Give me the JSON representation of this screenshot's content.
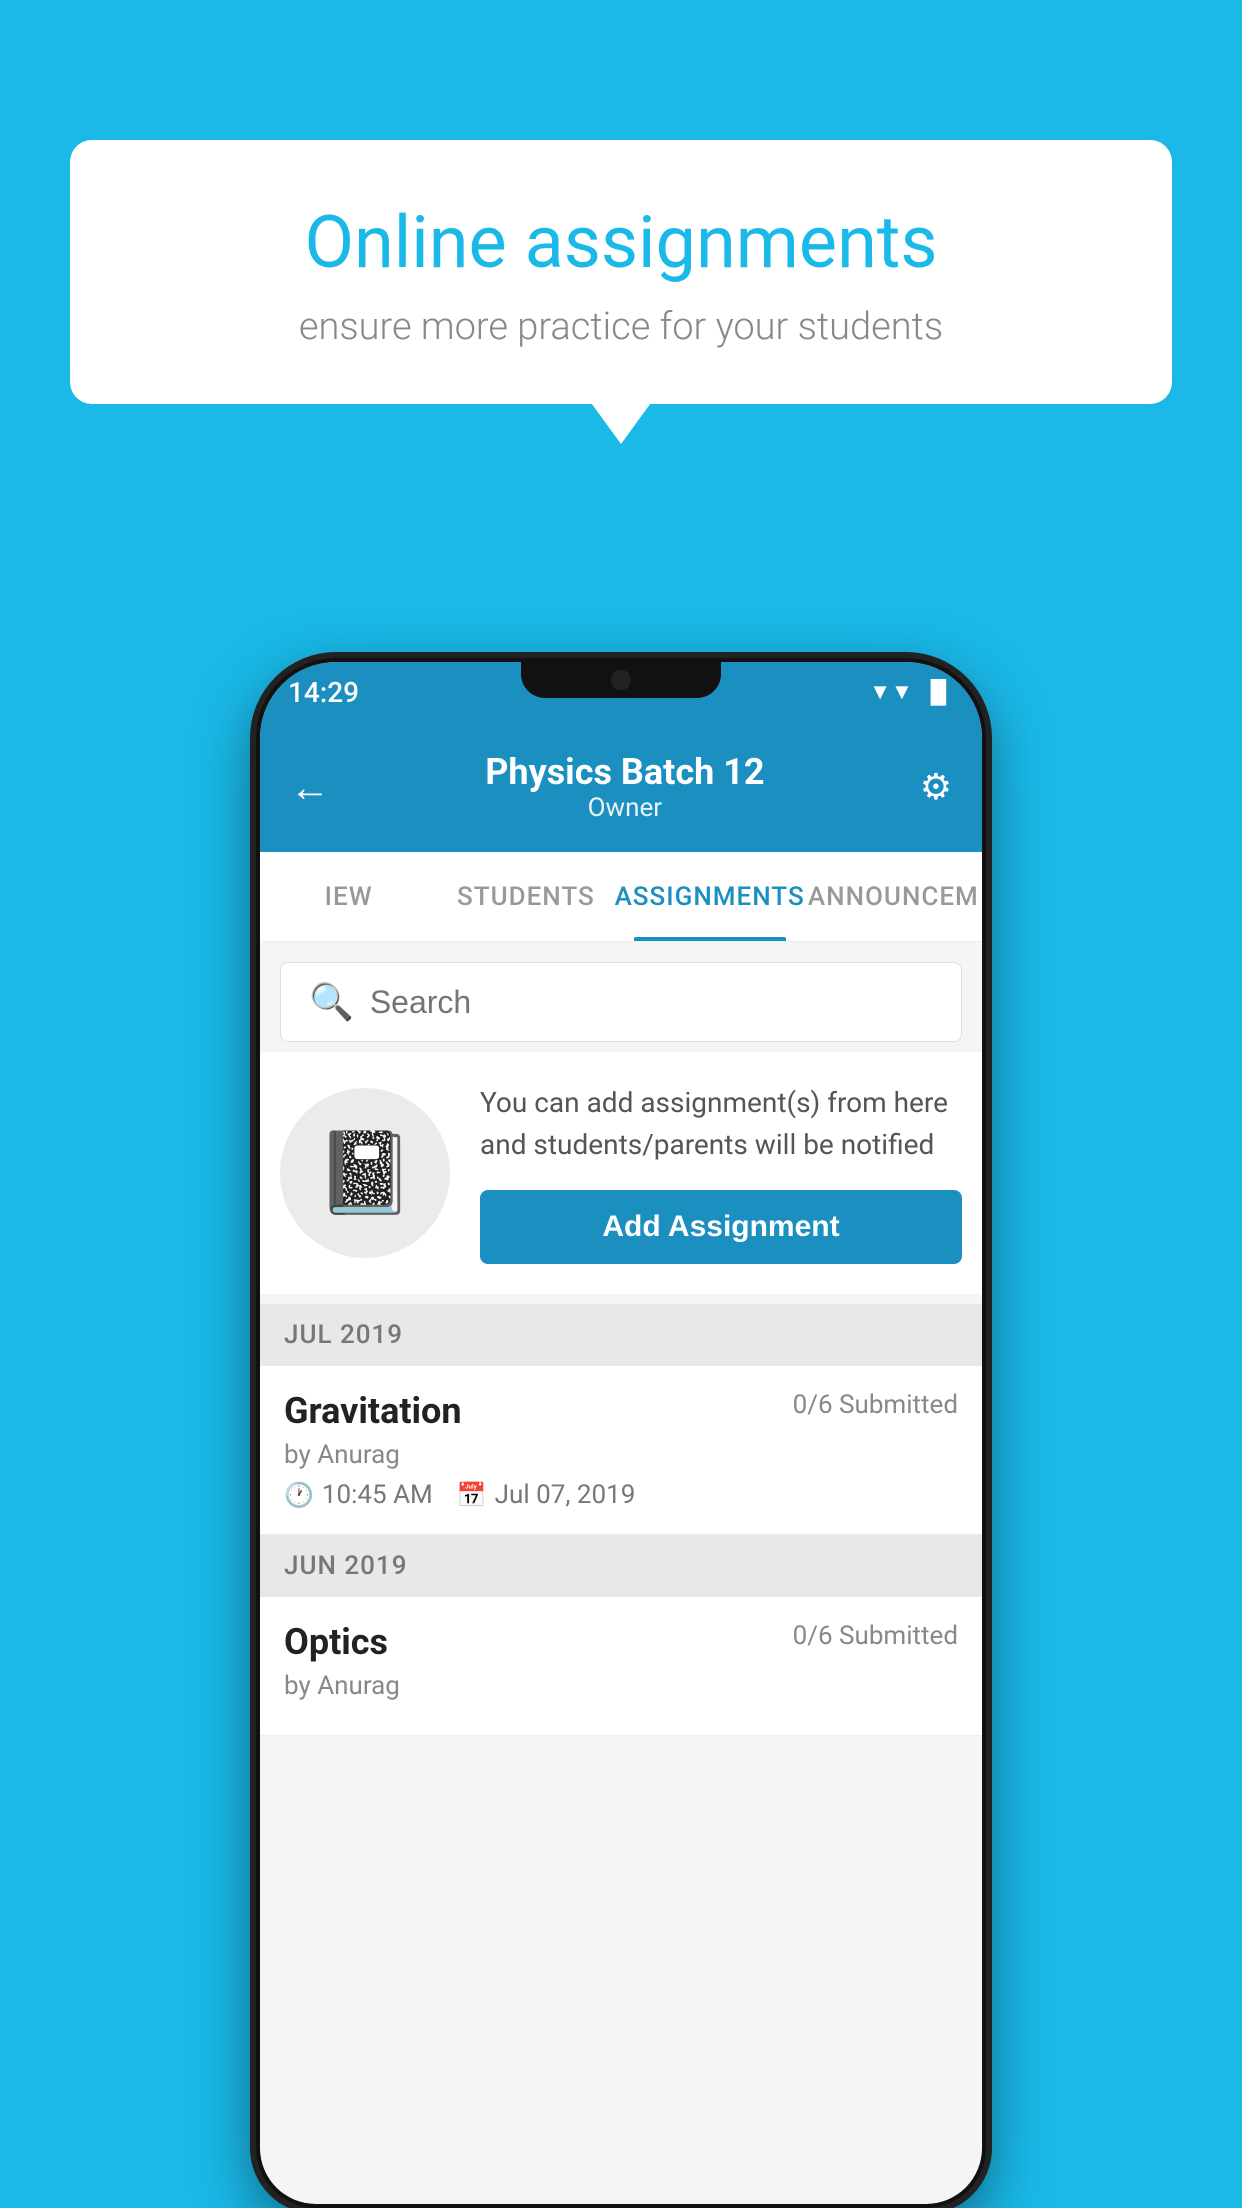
{
  "background_color": "#1ab9e8",
  "speech_bubble": {
    "title": "Online assignments",
    "subtitle": "ensure more practice for your students"
  },
  "status_bar": {
    "time": "14:29",
    "wifi_icon": "▼",
    "signal_icon": "▲",
    "battery_icon": "▐"
  },
  "header": {
    "title": "Physics Batch 12",
    "subtitle": "Owner",
    "back_label": "←",
    "settings_label": "⚙"
  },
  "tabs": [
    {
      "label": "IEW",
      "active": false
    },
    {
      "label": "STUDENTS",
      "active": false
    },
    {
      "label": "ASSIGNMENTS",
      "active": true
    },
    {
      "label": "ANNOUNCEM",
      "active": false
    }
  ],
  "search": {
    "placeholder": "Search"
  },
  "add_assignment_card": {
    "info_text": "You can add assignment(s) from here and students/parents will be notified",
    "button_label": "Add Assignment"
  },
  "sections": [
    {
      "month": "JUL 2019",
      "assignments": [
        {
          "name": "Gravitation",
          "submitted": "0/6 Submitted",
          "by": "by Anurag",
          "time": "10:45 AM",
          "date": "Jul 07, 2019"
        }
      ]
    },
    {
      "month": "JUN 2019",
      "assignments": [
        {
          "name": "Optics",
          "submitted": "0/6 Submitted",
          "by": "by Anurag",
          "time": "",
          "date": ""
        }
      ]
    }
  ]
}
